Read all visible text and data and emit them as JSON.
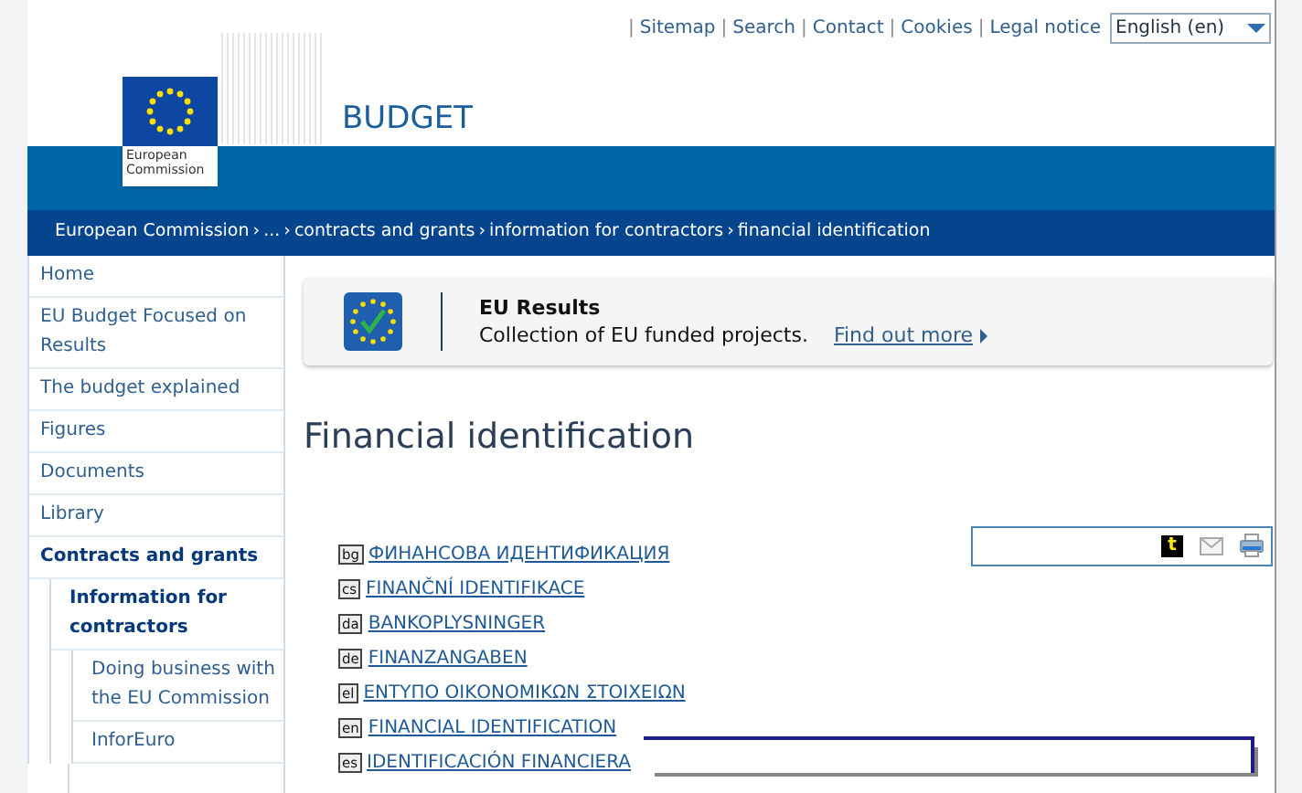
{
  "top_links": [
    "Sitemap",
    "Search",
    "Contact",
    "Cookies",
    "Legal notice"
  ],
  "link_separator": "|",
  "breadcrumb_separator": "›",
  "language_select": {
    "value": "English (en)"
  },
  "logo": {
    "line1": "European",
    "line2": "Commission"
  },
  "site_title": "BUDGET",
  "breadcrumb": [
    "European Commission",
    "...",
    "contracts and grants",
    "information for contractors",
    "financial identification"
  ],
  "sidebar": {
    "items": [
      {
        "label": "Home",
        "selected": false
      },
      {
        "label": "EU Budget Focused on Results",
        "selected": false
      },
      {
        "label": "The budget explained",
        "selected": false
      },
      {
        "label": "Figures",
        "selected": false
      },
      {
        "label": "Documents",
        "selected": false
      },
      {
        "label": "Library",
        "selected": false
      },
      {
        "label": "Contracts and grants",
        "selected": true,
        "children": [
          {
            "label": "Information for contractors",
            "selected": true,
            "children": [
              {
                "label": "Doing business with the EU Commission",
                "selected": false
              },
              {
                "label": "InforEuro",
                "selected": false
              }
            ]
          }
        ]
      }
    ]
  },
  "banner": {
    "title": "EU Results",
    "text": "Collection of EU funded projects.",
    "link": "Find out more"
  },
  "page_title": "Financial identification",
  "languages": [
    {
      "code": "bg",
      "label": "ФИНАНСОВА ИДЕНТИФИКАЦИЯ"
    },
    {
      "code": "cs",
      "label": "FINANČNÍ IDENTIFIKACE"
    },
    {
      "code": "da",
      "label": "BANKOPLYSNINGER"
    },
    {
      "code": "de",
      "label": "FINANZANGABEN"
    },
    {
      "code": "el",
      "label": "ΕΝΤΥΠΟ ΟΙΚΟΝΟΜΙΚΩΝ ΣΤΟΙΧΕΙΩΝ"
    },
    {
      "code": "en",
      "label": "FINANCIAL IDENTIFICATION"
    },
    {
      "code": "es",
      "label": "IDENTIFICACIÓN FINANCIERA"
    }
  ],
  "share_tools": {
    "t_label": "t"
  }
}
